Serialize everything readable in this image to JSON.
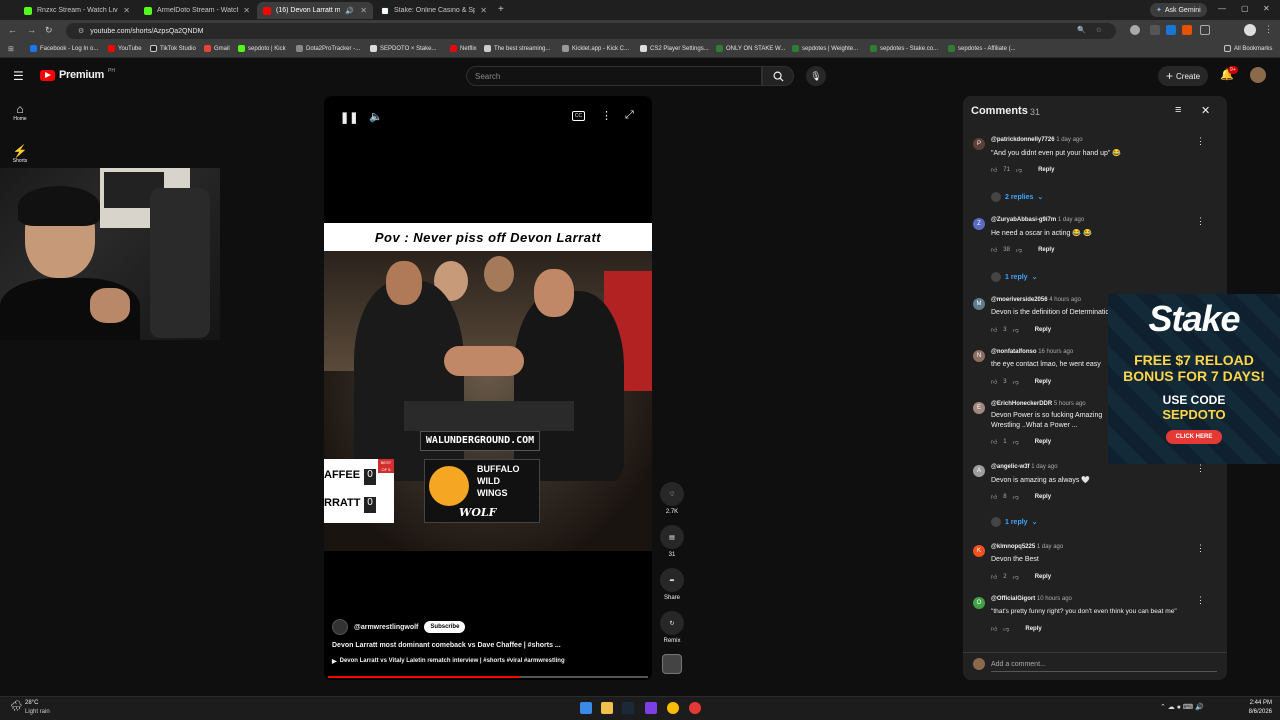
{
  "browser": {
    "tabs": [
      {
        "title": "Rnzxc Stream - Watch Live on Kick",
        "color": "#53fc18"
      },
      {
        "title": "ArmelDoto Stream - Watch Live on Kick",
        "color": "#53fc18"
      },
      {
        "title": "(16) Devon Larratt most dominant",
        "color": "#ff0000"
      },
      {
        "title": "Stake: Online Casino & Sports Betting",
        "color": "#1a2c38"
      }
    ],
    "url": "youtube.com/shorts/AzpsQa2QNDM",
    "ask_gemini": "Ask Gemini",
    "bookmarks": [
      "Facebook - Log In o...",
      "YouTube",
      "TikTok Studio",
      "Gmail",
      "sepdoto | Kick",
      "Dota2ProTracker -...",
      "SEPDOTO × Stake...",
      "Netflix",
      "The best streaming...",
      "Kicklet.app - Kick C...",
      "CS2 Player Settings...",
      "ONLY ON STAKE W...",
      "sepdotes | Weighte...",
      "sepdotes - Stake.co...",
      "sepdotes - Affiliate (..."
    ],
    "all_bookmarks": "All Bookmarks"
  },
  "youtube": {
    "logo": "Premium",
    "region": "PH",
    "search_placeholder": "Search",
    "create": "Create",
    "notif_count": "9+",
    "nav": [
      {
        "label": "Home"
      },
      {
        "label": "Shorts"
      }
    ]
  },
  "video": {
    "caption": "Pov : Never piss off Devon Larratt",
    "banner": "WALUNDERGROUND.COM",
    "score_label": "BEST OF 5",
    "names": [
      "AFFEE",
      "RRATT"
    ],
    "scores": [
      "0",
      "0"
    ],
    "sponsor_line1": "BUFFALO",
    "sponsor_line2": "WILD",
    "sponsor_line3": "WINGS",
    "sponsor_line4": "WOLF",
    "channel": "@armwrestlingwolf",
    "subscribe": "Subscribe",
    "title": "Devon Larratt most dominant comeback vs Dave Chaffee | #shorts ...",
    "related": "Devon Larratt vs Vitaly Laletin rematch interview | #shorts #viral #armwrestling",
    "likes": "2.7K",
    "comments_count": "31",
    "share": "Share",
    "remix": "Remix"
  },
  "comments": {
    "title": "Comments",
    "count": "31",
    "items": [
      {
        "handle": "@patrickdonnelly7726",
        "time": "1 day ago",
        "text": "\"And you didnt even put your hand up\" 😂",
        "likes": "71",
        "initial": "P",
        "color": "#5b4037",
        "replies": "2 replies"
      },
      {
        "handle": "@ZuryabAbbasi-g9i7m",
        "time": "1 day ago",
        "text": "He need a oscar in acting 😂 😂",
        "likes": "38",
        "initial": "Z",
        "color": "#5c6bc0",
        "replies": "1 reply"
      },
      {
        "handle": "@moeriverside2056",
        "time": "4 hours ago",
        "text": "Devon is the definition of Determination",
        "likes": "3",
        "initial": "M",
        "color": "#607d8b",
        "replies": ""
      },
      {
        "handle": "@nonfatalfonso",
        "time": "16 hours ago",
        "text": "the eye contact lmao, he went easy",
        "likes": "3",
        "initial": "N",
        "color": "#8d6e63",
        "replies": ""
      },
      {
        "handle": "@ErichHoneckerDDR",
        "time": "5 hours ago",
        "text": "Devon Power is so fucking Amazing",
        "text2": "Wrestling ..What a Power ...",
        "likes": "1",
        "initial": "E",
        "color": "#a1887f",
        "replies": ""
      },
      {
        "handle": "@angelic-w3f",
        "time": "1 day ago",
        "text": "Devon is amazing as always 🤍",
        "likes": "8",
        "initial": "A",
        "color": "#9e9e9e",
        "replies": "1 reply"
      },
      {
        "handle": "@klmnopq5225",
        "time": "1 day ago",
        "text": "Devon the Best",
        "likes": "2",
        "initial": "K",
        "color": "#f4511e",
        "replies": ""
      },
      {
        "handle": "@OfficialGigort",
        "time": "10 hours ago",
        "text": "\"that's pretty funny right? you don't even think you can beat me\"",
        "likes": "",
        "initial": "O",
        "color": "#43a047",
        "replies": ""
      }
    ],
    "reply_label": "Reply",
    "add_placeholder": "Add a comment..."
  },
  "ad": {
    "brand": "Stake",
    "headline1": "FREE $7 RELOAD",
    "headline2": "BONUS FOR 7 DAYS!",
    "use_code": "USE CODE",
    "code": "SEPDOTO",
    "cta": "CLICK HERE"
  },
  "taskbar": {
    "temp": "28°C",
    "weather": "Light rain",
    "time": "2:44 PM",
    "date": "8/6/2026"
  }
}
